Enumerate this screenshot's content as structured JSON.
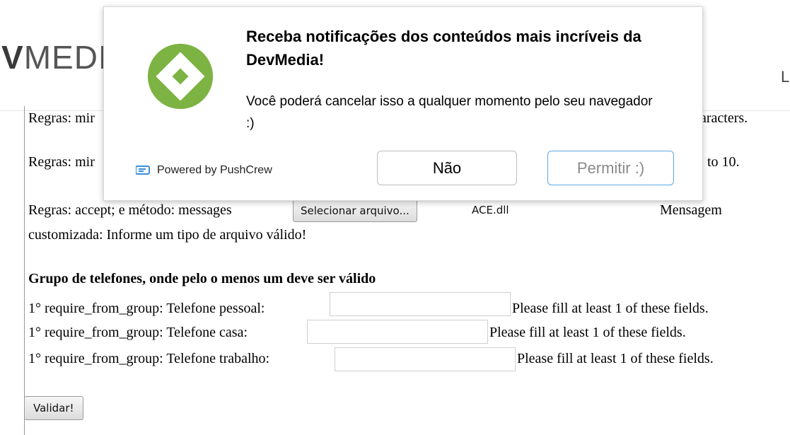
{
  "header": {
    "logo_prefix": "V",
    "logo_rest": "MEDI",
    "right_partial": "L"
  },
  "form": {
    "row1_left": "Regras: mir",
    "row1_right": "aracters.",
    "row2_left": "Regras: mir",
    "row2_right": "to 10.",
    "row3_label": "Regras: accept; e método: messages",
    "file_button": "Selecionar arquivo...",
    "file_name": "ACE.dll",
    "row3_msg": "Mensagem",
    "row3_msg_cont": "customizada: Informe um tipo de arquivo válido!",
    "group_title": "Grupo de telefones, onde pelo o menos um deve ser válido",
    "phones": [
      {
        "label": "1° require_from_group: Telefone pessoal:",
        "value": "",
        "error": "Please fill at least 1 of these fields."
      },
      {
        "label": "1° require_from_group: Telefone casa:",
        "value": "",
        "error": "Please fill at least 1 of these fields."
      },
      {
        "label": "1° require_from_group: Telefone trabalho:",
        "value": "",
        "error": "Please fill at least 1 of these fields."
      }
    ],
    "submit_label": "Validar!"
  },
  "popup": {
    "title": "Receba notificações dos conteúdos mais incríveis da DevMedia!",
    "text": "Você poderá cancelar isso a qualquer momento pelo seu navegador :)",
    "powered_by": "Powered by PushCrew",
    "no_button": "Não",
    "yes_button": "Permitir :)",
    "brand_color": "#7cb342",
    "accent_border": "#5aa8e6",
    "icons": [
      "devmedia-logo-icon",
      "pushcrew-icon"
    ]
  }
}
